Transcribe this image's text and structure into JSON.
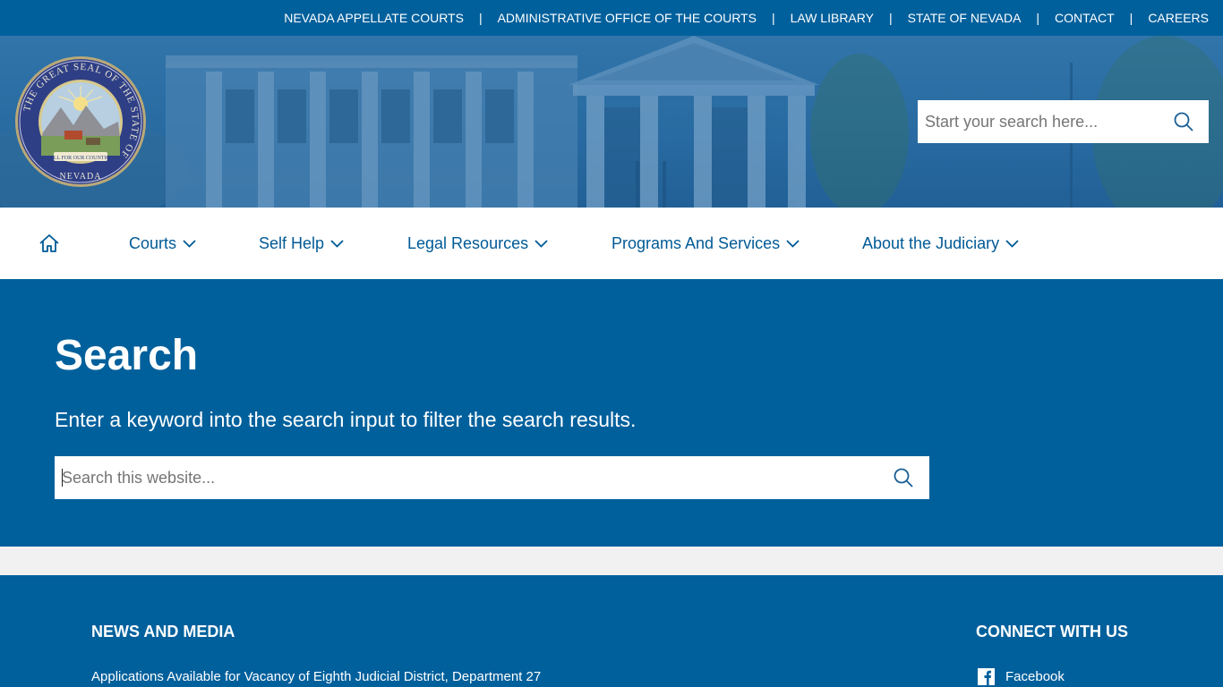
{
  "top_links": [
    "NEVADA APPELLATE COURTS",
    "ADMINISTRATIVE OFFICE OF THE COURTS",
    "LAW LIBRARY",
    "STATE OF NEVADA",
    "CONTACT",
    "CAREERS"
  ],
  "top_separator": "|",
  "seal": {
    "ring_text": "THE GREAT SEAL OF THE STATE OF",
    "state": "NEVADA",
    "motto": "ALL FOR OUR COUNTRY"
  },
  "header_search": {
    "placeholder": "Start your search here..."
  },
  "nav": {
    "home_icon": "home-icon",
    "items": [
      "Courts",
      "Self Help",
      "Legal Resources",
      "Programs And Services",
      "About the Judiciary"
    ]
  },
  "main": {
    "title": "Search",
    "description": "Enter a keyword into the search input to filter the search results.",
    "search_placeholder": "Search this website..."
  },
  "footer": {
    "news_heading": "NEWS AND MEDIA",
    "news_item": "Applications Available for Vacancy of Eighth Judicial District, Department 27",
    "connect_heading": "CONNECT WITH US",
    "facebook_label": "Facebook",
    "facebook_icon": "facebook-icon"
  },
  "colors": {
    "brand_blue": "#00609c",
    "nav_text": "#005a96",
    "divider": "#f1f1f1"
  }
}
